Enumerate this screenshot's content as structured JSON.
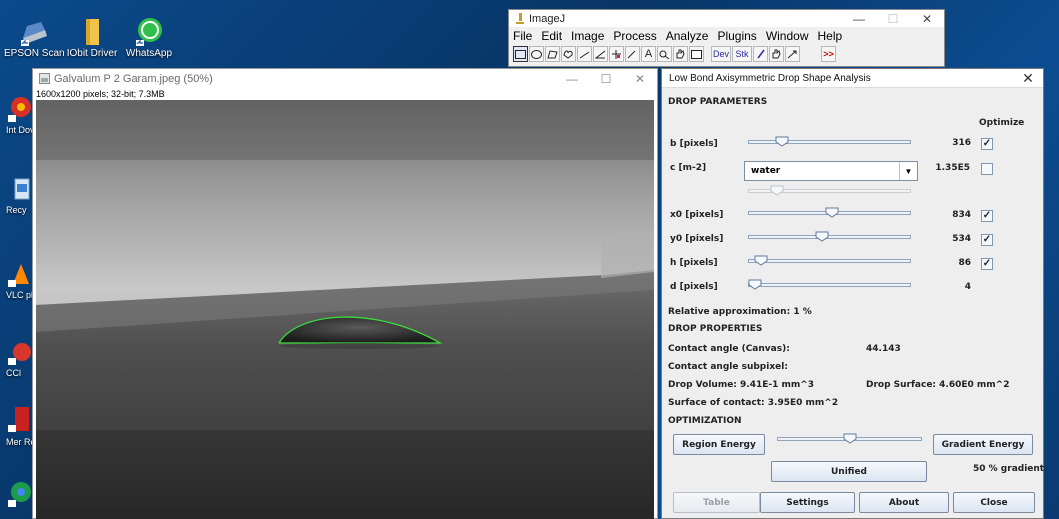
{
  "desktop": {
    "icons": [
      {
        "label": "EPSON Scan",
        "icon": "scanner-icon"
      },
      {
        "label": "IObit Driver",
        "icon": "folder-icon"
      },
      {
        "label": "WhatsApp",
        "icon": "whatsapp-icon"
      },
      {
        "label": "Int Dov",
        "icon": "chrome-icon"
      },
      {
        "label": "Recy",
        "icon": "recycle-bin-icon"
      },
      {
        "label": "VLC pl",
        "icon": "vlc-icon"
      },
      {
        "label": "CCl",
        "icon": "ccleaner-icon"
      },
      {
        "label": "Mer Refe",
        "icon": "app-icon"
      }
    ]
  },
  "imagej": {
    "title": "ImageJ",
    "menu": [
      "File",
      "Edit",
      "Image",
      "Process",
      "Analyze",
      "Plugins",
      "Window",
      "Help"
    ],
    "tools": [
      "rectangle-tool-icon",
      "oval-tool-icon",
      "polygon-tool-icon",
      "freehand-tool-icon",
      "line-tool-icon",
      "angle-tool-icon",
      "point-tool-icon",
      "wand-tool-icon",
      "text-tool-icon",
      "magnifier-tool-icon",
      "hand-tool-icon",
      "color-picker-icon",
      "dev-tool-icon",
      "stack-tool-icon",
      "brush-tool-icon",
      "flood-fill-icon",
      "arrow-tool-icon",
      "more-tools-icon"
    ],
    "dev_label": "Dev",
    "stk_label": "Stk",
    "more_label": ">>"
  },
  "image_window": {
    "title": "Galvalum P 2 Garam.jpeg (50%)",
    "info": "1600x1200 pixels; 32-bit; 7.3MB"
  },
  "dialog": {
    "title": "Low Bond Axisymmetric Drop Shape Analysis",
    "drop_parameters": {
      "header": "DROP PARAMETERS",
      "optimize_label": "Optimize",
      "b": {
        "label": "b [pixels]",
        "value": "316",
        "optimize": true,
        "slider": 0.18
      },
      "c": {
        "label": "c [m-2]",
        "value": "1.35E5",
        "optimize": false,
        "combo": "water",
        "slider": 0.15
      },
      "x0": {
        "label": "x0 [pixels]",
        "value": "834",
        "optimize": true,
        "slider": 0.52
      },
      "y0": {
        "label": "y0 [pixels]",
        "value": "534",
        "optimize": true,
        "slider": 0.45
      },
      "h": {
        "label": "h [pixels]",
        "value": "86",
        "optimize": true,
        "slider": 0.04
      },
      "d": {
        "label": "d [pixels]",
        "value": "4",
        "slider": 0.0
      },
      "relative_approx": "Relative approximation: 1 %"
    },
    "drop_properties": {
      "header": "DROP PROPERTIES",
      "contact_angle_canvas_label": "Contact angle (Canvas):",
      "contact_angle_canvas_value": "44.143",
      "contact_angle_subpixel_label": "Contact angle subpixel:",
      "drop_volume": "Drop Volume: 9.41E-1 mm^3",
      "drop_surface": "Drop Surface: 4.60E0 mm^2",
      "surface_contact": "Surface of contact: 3.95E0 mm^2"
    },
    "optimization": {
      "header": "OPTIMIZATION",
      "region_energy": "Region Energy",
      "gradient_energy": "Gradient Energy",
      "unified": "Unified",
      "gradient_pct": "50 % gradient",
      "slider": 0.5
    },
    "buttons": {
      "table": "Table",
      "settings": "Settings",
      "about": "About",
      "close": "Close"
    }
  },
  "colors": {
    "fit_curve": "#3ddc3d",
    "dialog_bg": "#eeeeee",
    "desktop_bg": "#0a3f78"
  }
}
